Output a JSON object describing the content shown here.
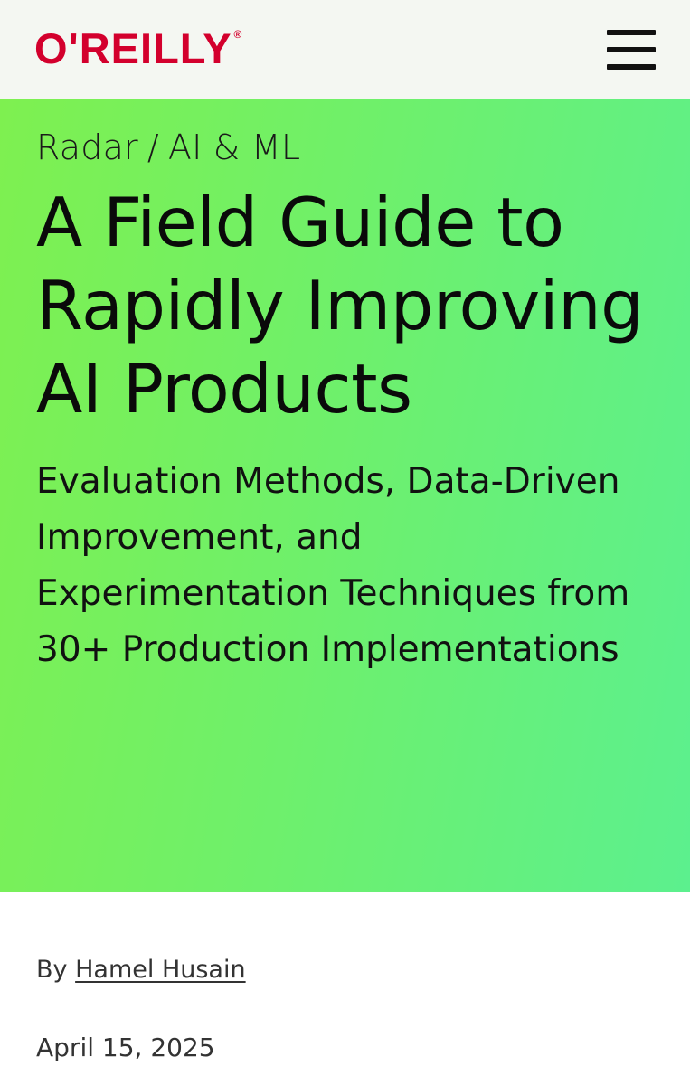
{
  "header": {
    "logo_text": "O'REILLY",
    "logo_mark": "®",
    "menu_icon": "hamburger-menu-icon",
    "brand_color": "#d3002d"
  },
  "hero": {
    "breadcrumb": [
      "Radar",
      "AI & ML"
    ],
    "breadcrumb_separator": "/",
    "title": "A Field Guide to Rapidly Improving AI Products",
    "subtitle": "Evaluation Methods, Data-Driven Improvement, and Experimentation Techniques from 30+ Production Implementations",
    "background_colors": [
      "#7ef050",
      "#5cf08e"
    ]
  },
  "meta": {
    "by_label": "By",
    "author": "Hamel Husain",
    "date": "April 15, 2025"
  }
}
